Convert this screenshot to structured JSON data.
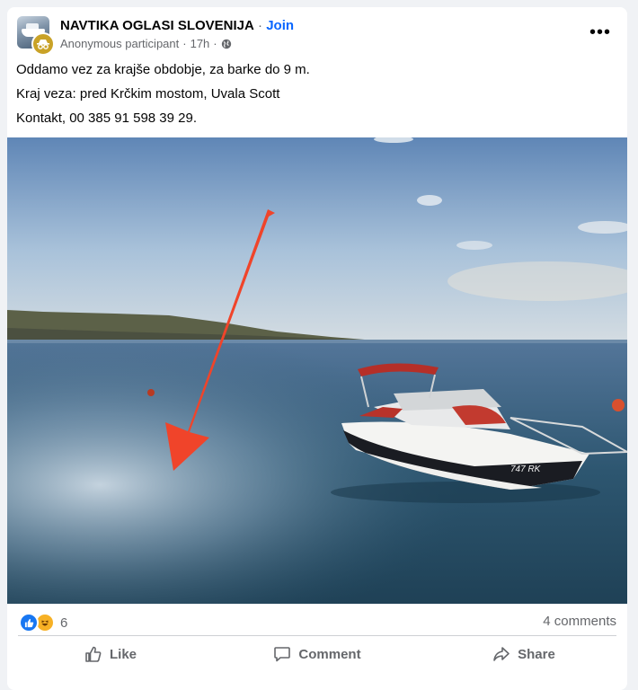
{
  "post": {
    "group_name": "NAVTIKA OGLASI SLOVENIJA",
    "separator": " · ",
    "join_label": "Join",
    "author": "Anonymous participant",
    "time": "17h",
    "body_lines": [
      "Oddamo vez za krajše obdobje, za barke do 9 m.",
      "Kraj veza: pred Krčkim mostom, Uvala Scott",
      "Kontakt, 00 385 91 598 39 29."
    ],
    "photo_boat_text": "747 RK"
  },
  "stats": {
    "reaction_count": "6",
    "comments_label": "4 comments"
  },
  "actions": {
    "like_label": "Like",
    "comment_label": "Comment",
    "share_label": "Share"
  },
  "colors": {
    "accent": "#0866ff",
    "arrow": "#f0442a",
    "like_blue": "#1877f2",
    "haha_yellow": "#f7b125"
  }
}
